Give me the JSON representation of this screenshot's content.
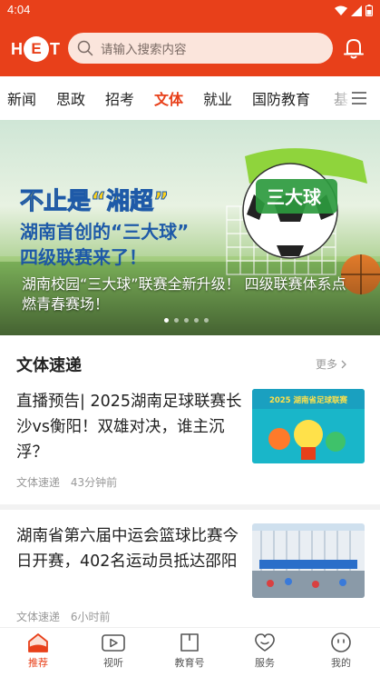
{
  "status": {
    "time": "4:04"
  },
  "logo": {
    "left": "H",
    "center": "E",
    "right": "T"
  },
  "search": {
    "placeholder": "请输入搜索内容"
  },
  "tabs": [
    "新闻",
    "思政",
    "招考",
    "文体",
    "就业",
    "国防教育",
    "基"
  ],
  "active_tab": "文体",
  "banner": {
    "headline_1": "不止是“湘超”",
    "headline_2": "湖南首创的“三大球”",
    "headline_3": "四级联赛来了！",
    "ball_label": "三大球",
    "caption": "湖南校园“三大球”联赛全新升级！ 四级联赛体系点燃青春赛场！",
    "slide_count": 5,
    "active_slide": 1
  },
  "section": {
    "title": "文体速递",
    "more": "更多"
  },
  "news": [
    {
      "title": "直播预告| 2025湖南足球联赛长沙vs衡阳！双雄对决，谁主沉浮？",
      "source": "文体速递",
      "time": "43分钟前",
      "thumb_text": "2025 湖南省足球联赛"
    },
    {
      "title": "湖南省第六届中运会篮球比赛今日开赛，402名运动员抵达邵阳",
      "source": "文体速递",
      "time": "6小时前",
      "thumb_text": ""
    }
  ],
  "bottom_nav": [
    "推荐",
    "视听",
    "教育号",
    "服务",
    "我的"
  ],
  "colors": {
    "brand": "#e8401a",
    "search_bg": "#fbe5dc",
    "muted": "#999999"
  }
}
